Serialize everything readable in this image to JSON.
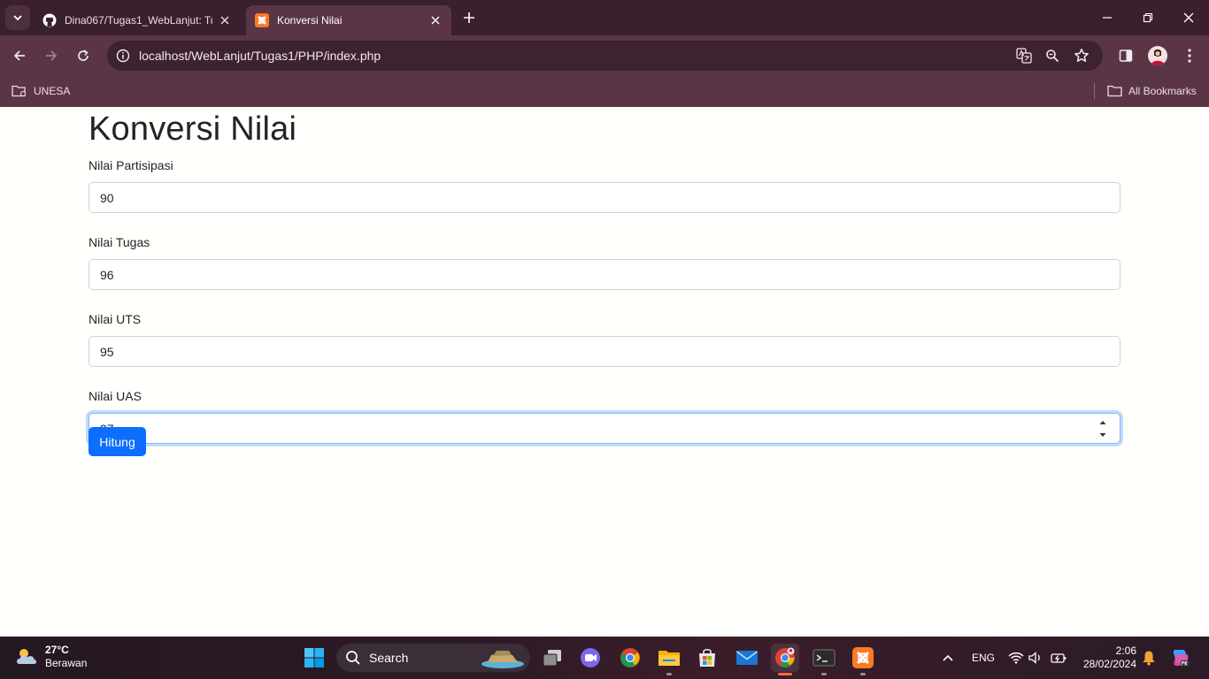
{
  "browser": {
    "tabs": [
      {
        "title": "Dina067/Tugas1_WebLanjut: Tu",
        "active": false
      },
      {
        "title": "Konversi Nilai",
        "active": true
      }
    ],
    "url": "localhost/WebLanjut/Tugas1/PHP/index.php",
    "bookmarks": {
      "folder": "UNESA",
      "all": "All Bookmarks"
    }
  },
  "page": {
    "title": "Konversi Nilai",
    "fields": [
      {
        "label": "Nilai Partisipasi",
        "value": "90"
      },
      {
        "label": "Nilai Tugas",
        "value": "96"
      },
      {
        "label": "Nilai UTS",
        "value": "95"
      },
      {
        "label": "Nilai UAS",
        "value": "97"
      }
    ],
    "submit_label": "Hitung"
  },
  "taskbar": {
    "weather": {
      "temp": "27°C",
      "condition": "Berawan"
    },
    "search_label": "Search",
    "language": "ENG",
    "time": "2:06",
    "date": "28/02/2024"
  },
  "colors": {
    "chrome_dark": "#3a1f2d",
    "chrome_toolbar": "#5a3545",
    "primary_button": "#0d6efd",
    "focus_border": "#86b7fe"
  }
}
